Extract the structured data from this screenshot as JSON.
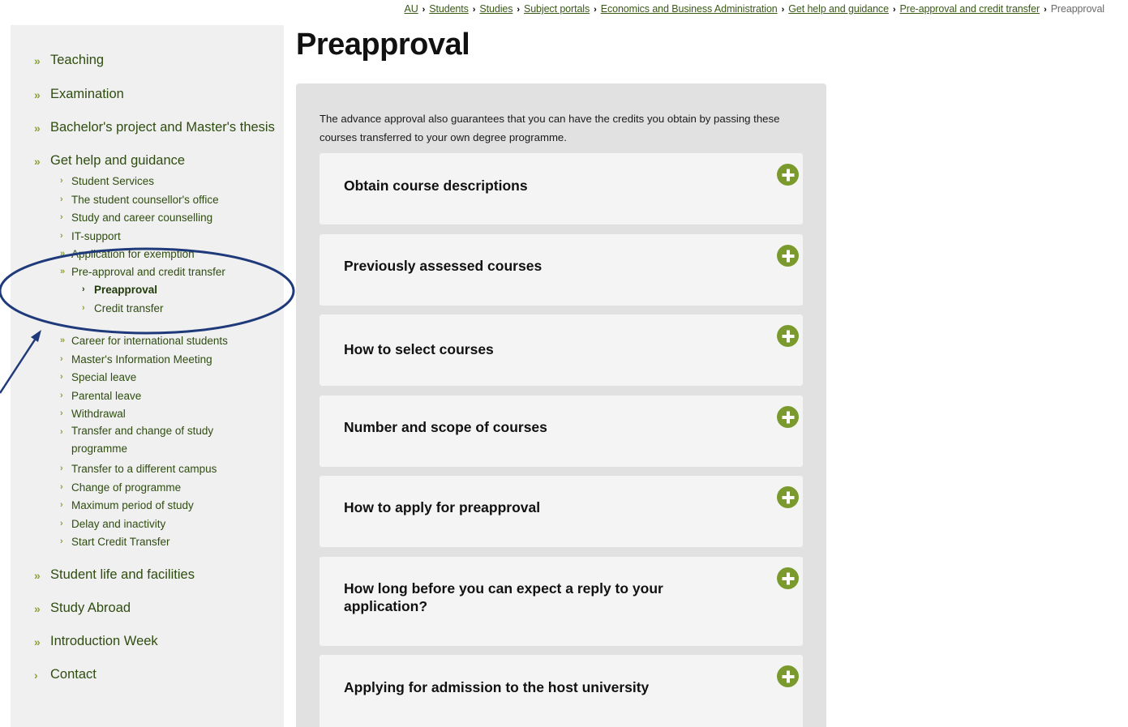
{
  "breadcrumb": {
    "items": [
      "AU",
      "Students",
      "Studies",
      "Subject portals",
      "Economics and Business Administration",
      "Get help and guidance",
      "Pre-approval and credit transfer"
    ],
    "current": "Preapproval"
  },
  "sidebar": {
    "top_items": {
      "teaching": "Teaching",
      "examination": "Examination",
      "bachelor_project": "Bachelor's project and Master's thesis",
      "get_help": "Get help and guidance",
      "student_life": "Student life and facilities",
      "study_abroad": "Study Abroad",
      "introduction_week": "Introduction Week",
      "contact": "Contact"
    },
    "help_items": [
      "Student Services",
      "The student counsellor's office",
      "Study and career counselling",
      "IT-support",
      "Application for exemption",
      "Pre-approval and credit transfer",
      "Career for international students",
      "Master's Information Meeting",
      "Special leave",
      "Parental leave",
      "Withdrawal",
      "Transfer and change of study programme",
      "Transfer to a different campus",
      "Change of programme",
      "Maximum period of study",
      "Delay and inactivity",
      "Start Credit Transfer"
    ],
    "preapproval_items": [
      "Preapproval",
      "Credit transfer"
    ]
  },
  "main": {
    "title": "Preapproval",
    "intro": "The advance approval also guarantees that you can have the credits you obtain by passing these courses transferred to your own degree programme.",
    "accordions": [
      "Obtain course descriptions",
      "Previously assessed courses",
      "How to select courses",
      "Number and scope of courses",
      "How to apply for preapproval",
      "How long before you can expect a reply to your application?",
      "Applying for admission to the host university"
    ]
  },
  "colors": {
    "accent_green": "#7a9a2e",
    "link_green": "#2f4d10",
    "annotation_blue": "#1f3a7a"
  },
  "icons": {
    "expand": "plus-circle-icon",
    "nav_marker": "double-chevron-icon"
  }
}
